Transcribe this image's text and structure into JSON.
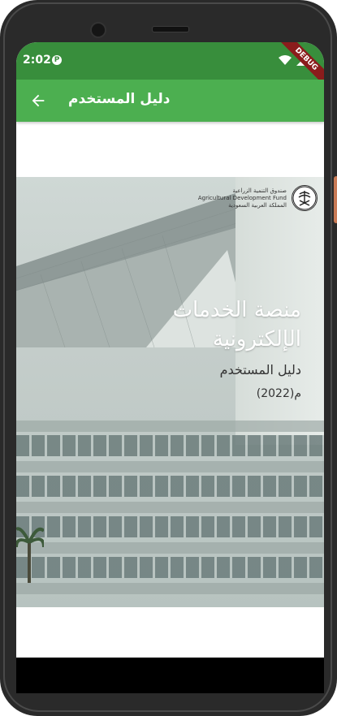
{
  "status_bar": {
    "time": "2:02",
    "p_icon": "P",
    "debug_label": "DEBUG"
  },
  "app_bar": {
    "title": "دليل المستخدم",
    "back_icon": "arrow-back-icon"
  },
  "cover": {
    "logo_line1": "صندوق التنمية الزراعية",
    "logo_line2": "Agricultural Development Fund",
    "logo_line3": "المملكة العربية السعودية",
    "title_line1": "منصة الخدمات",
    "title_line2": "الإلكترونية",
    "subtitle": "دليل المستخدم",
    "year": "(2022)م"
  },
  "colors": {
    "status_bar": "#388e3c",
    "app_bar": "#4caf50",
    "debug_ribbon": "#8b1c1c"
  }
}
